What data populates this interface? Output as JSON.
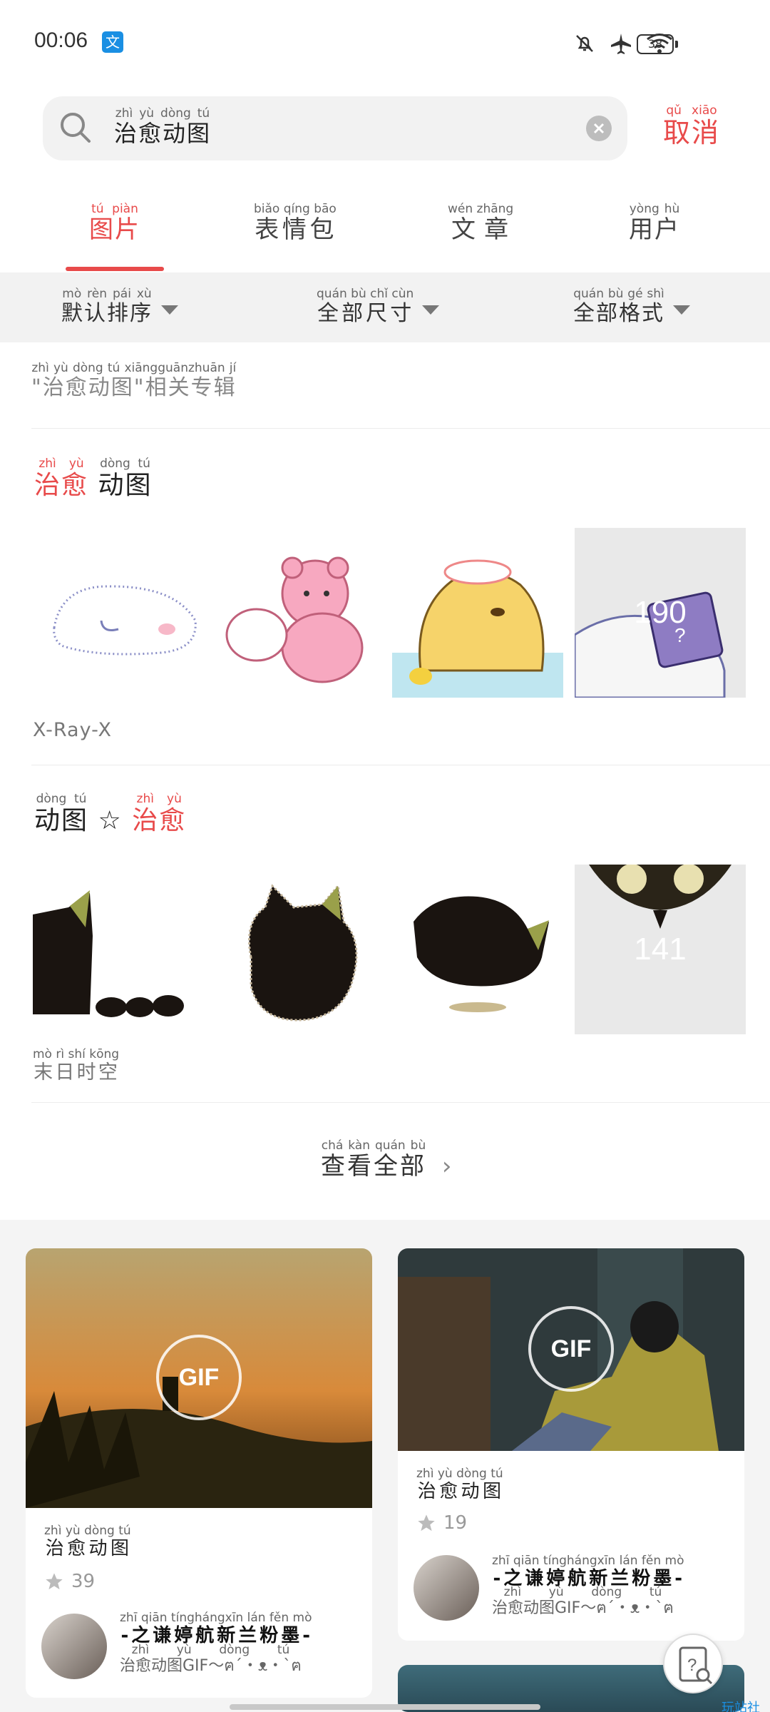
{
  "status": {
    "time": "00:06",
    "app_badge": "文",
    "battery": "38"
  },
  "search": {
    "query": "治愈动图",
    "query_pinyin": "zhì yù dòng tú",
    "cancel": "取消",
    "cancel_pinyin": "qǔ xiāo"
  },
  "tabs": [
    {
      "label": "图片",
      "pinyin": "tú piàn",
      "active": true
    },
    {
      "label": "表情包",
      "pinyin": "biǎo qíng bāo",
      "active": false
    },
    {
      "label": "文章",
      "pinyin": "wén zhāng",
      "active": false
    },
    {
      "label": "用户",
      "pinyin": "yòng hù",
      "active": false
    }
  ],
  "filters": [
    {
      "label": "默认排序",
      "pinyin": "mò rèn pái xù"
    },
    {
      "label": "全部尺寸",
      "pinyin": "quán bù chǐ cùn"
    },
    {
      "label": "全部格式",
      "pinyin": "quán bù gé shì"
    }
  ],
  "related": {
    "label": "\"治愈动图\"相关专辑",
    "pinyin": "zhì yù dòng tú xiāngguānzhuān jí"
  },
  "albums": [
    {
      "title_red": "治愈",
      "title_red_pinyin": "zhì yù",
      "title_black": "动图",
      "title_black_pinyin": "dòng tú",
      "author": "X-Ray-X",
      "more_count": "190"
    },
    {
      "title_black": "动图",
      "title_black_pinyin": "dòng tú",
      "star": "☆",
      "title_red": "治愈",
      "title_red_pinyin": "zhì yù",
      "author": "末日时空",
      "author_pinyin": "mò rì shí kōng",
      "more_count": "141"
    }
  ],
  "view_all": {
    "label": "查看全部",
    "pinyin": "chá kàn quán bù",
    "chevron": "›"
  },
  "cards": [
    {
      "badge": "GIF",
      "title": "治愈动图",
      "title_pinyin": "zhì yù dòng tú",
      "stars": "39",
      "user_name": "-之谦婷航新兰粉墨-",
      "user_pinyin": "zhī qiān tínghángxīn lán fěn mò",
      "user_desc": "治愈动图GIF～ฅ´・ᴥ・`ฅ",
      "user_desc_pinyin": "zhì yù dòng tú"
    },
    {
      "badge": "GIF",
      "title": "治愈动图",
      "title_pinyin": "zhì yù dòng tú",
      "stars": "19",
      "user_name": "-之谦婷航新兰粉墨-",
      "user_pinyin": "zhī qiān tínghángxīn lán fěn mò",
      "user_desc": "治愈动图GIF～ฅ´・ᴥ・`ฅ",
      "user_desc_pinyin": "zhì yù dòng tú"
    }
  ],
  "corner_label": "玩站社区",
  "colors": {
    "accent": "#e84a4a",
    "filter_bg": "#f2f2f2",
    "feed_bg": "#f4f4f4"
  }
}
